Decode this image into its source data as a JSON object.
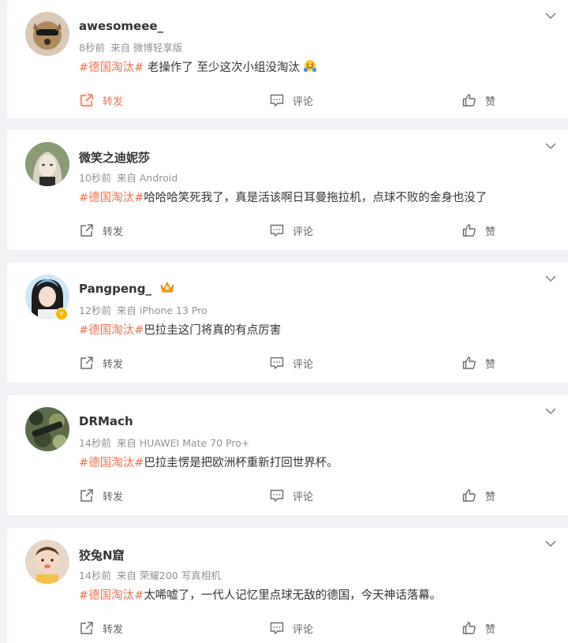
{
  "posts": [
    {
      "username": "awesomeee_",
      "time": "8秒前",
      "source": "来自 微博轻享版",
      "hashtag": "#德国淘汰#",
      "body": " 老操作了 至少这次小组没淘汰",
      "has_emoji": true,
      "repost_highlight": true
    },
    {
      "username": "微笑之迪妮莎",
      "time": "10秒前",
      "source": "来自 Android",
      "hashtag": "#德国淘汰#",
      "body": "哈哈哈笑死我了，真是活该啊日耳曼拖拉机，点球不败的金身也没了"
    },
    {
      "username": "Pangpeng_",
      "time": "12秒前",
      "source": "来自 iPhone 13 Pro",
      "hashtag": "#德国淘汰#",
      "body": "巴拉圭这门将真的有点厉害",
      "has_crown": true,
      "verified": true
    },
    {
      "username": "DRMach",
      "time": "14秒前",
      "source": "来自 HUAWEI Mate 70 Pro+",
      "hashtag": "#德国淘汰#",
      "body": "巴拉圭愣是把欧洲杯重新打回世界杯。"
    },
    {
      "username": "狡兔N窟",
      "time": "14秒前",
      "source": "来自 荣耀200 写真相机",
      "hashtag": "#德国淘汰#",
      "body": "太唏嘘了，一代人记忆里点球无敌的德国，今天神话落幕。"
    }
  ],
  "actions": {
    "repost": "转发",
    "comment": "评论",
    "like": "赞"
  },
  "icons": {
    "menu": "chevron-down-icon",
    "repost": "repost-icon",
    "comment": "comment-icon",
    "like": "thumbs-up-icon",
    "emoji": "hug-emoji-icon",
    "crown": "crown-badge-icon"
  },
  "colors": {
    "hashtag": "#eb7350",
    "text": "#333333",
    "meta": "#939393",
    "background": "#f1f2f5"
  }
}
